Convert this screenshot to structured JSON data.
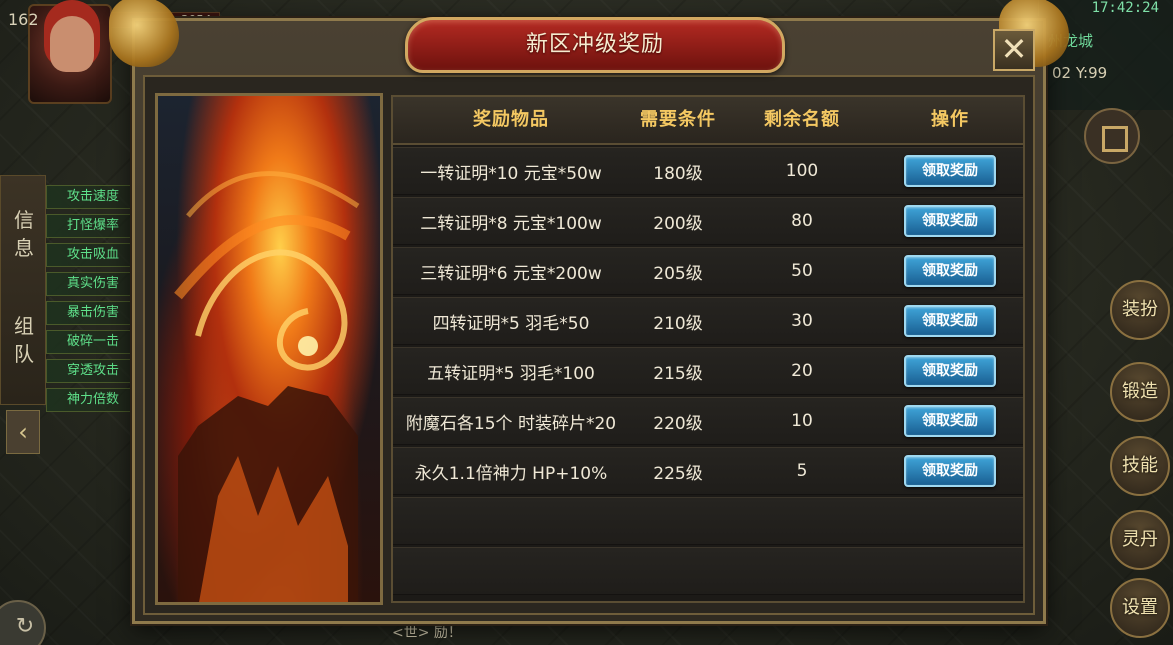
{
  "hud": {
    "level": "162",
    "hp_text": "3054",
    "time": "17:42:24",
    "city": "州龙城",
    "coords": "02  Y:99",
    "side_tabs": [
      "信息",
      "组队"
    ],
    "stats": [
      "攻击速度",
      "打怪爆率",
      "攻击吸血",
      "真实伤害",
      "暴击伤害",
      "破碎一击",
      "穿透攻击",
      "神力倍数"
    ],
    "collapse_icon": "‹",
    "refresh_icon": "↻",
    "chat_text": "<世> 励！",
    "buttons": {
      "dress": "装扮",
      "forge": "锻造",
      "skill": "技能",
      "elixir": "灵丹",
      "settings": "设置"
    }
  },
  "dialog": {
    "title": "新区冲级奖励",
    "close_icon": "✕",
    "columns": [
      "奖励物品",
      "需要条件",
      "剩余名额",
      "操作"
    ],
    "claim_label": "领取奖励",
    "rows": [
      {
        "item": "一转证明*10  元宝*50w",
        "condition": "180级",
        "remaining": "100"
      },
      {
        "item": "二转证明*8  元宝*100w",
        "condition": "200级",
        "remaining": "80"
      },
      {
        "item": "三转证明*6  元宝*200w",
        "condition": "205级",
        "remaining": "50"
      },
      {
        "item": "四转证明*5   羽毛*50",
        "condition": "210级",
        "remaining": "30"
      },
      {
        "item": "五转证明*5   羽毛*100",
        "condition": "215级",
        "remaining": "20"
      },
      {
        "item": "附魔石各15个  时装碎片*20",
        "condition": "220级",
        "remaining": "10"
      },
      {
        "item": "永久1.1倍神力  HP+10%",
        "condition": "225级",
        "remaining": "5"
      }
    ]
  },
  "colors": {
    "header_text": "#f4c862",
    "title_plate": "#b42a22",
    "claim_button": "#2a7fb8",
    "stat_text": "#5fe08a"
  },
  "icons": [
    "close-icon",
    "dragon-ornament-icon",
    "refresh-icon",
    "chevron-left-icon",
    "map-icon"
  ]
}
